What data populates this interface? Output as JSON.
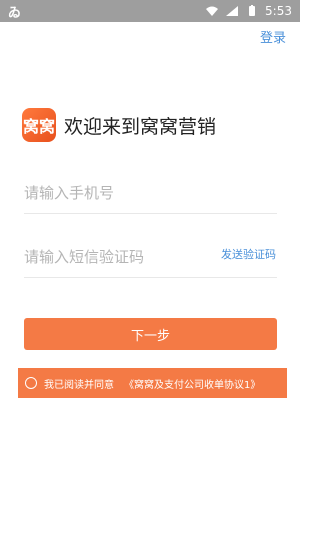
{
  "status_bar": {
    "left_icon": "ゐ",
    "time": "5:53",
    "icons": [
      "wifi-icon",
      "signal-icon",
      "battery-icon"
    ]
  },
  "header": {
    "login_label": "登录"
  },
  "brand": {
    "logo_text": "窝窝",
    "title": "欢迎来到窝窝营销"
  },
  "form": {
    "phone_placeholder": "请输入手机号",
    "code_placeholder": "请输入短信验证码",
    "send_code_label": "发送验证码",
    "next_label": "下一步"
  },
  "agreement": {
    "text": "我已阅读并同意",
    "document": "《窝窝及支付公司收单协议1》"
  },
  "colors": {
    "accent": "#f47a45",
    "link": "#4a90d9",
    "statusbar": "#9e9e9e"
  }
}
